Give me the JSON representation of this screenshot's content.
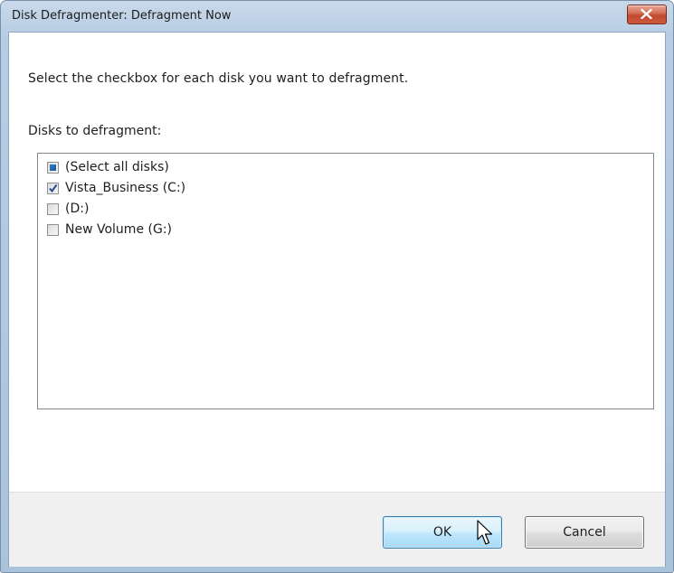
{
  "window": {
    "title": "Disk Defragmenter: Defragment Now"
  },
  "dialog": {
    "instruction": "Select the checkbox for each disk you want to defragment.",
    "list_label": "Disks to defragment:",
    "disks": [
      {
        "label": "(Select all disks)",
        "state": "indeterminate"
      },
      {
        "label": "Vista_Business (C:)",
        "state": "checked"
      },
      {
        "label": "(D:)",
        "state": "unchecked"
      },
      {
        "label": "New Volume (G:)",
        "state": "unchecked"
      }
    ]
  },
  "buttons": {
    "ok": "OK",
    "cancel": "Cancel"
  },
  "icons": {
    "close": "close-icon",
    "checkmark": "checkmark-icon",
    "cursor": "mouse-pointer-icon"
  },
  "colors": {
    "accent": "#3c7fb1",
    "close_button": "#c14a30",
    "indeterminate": "#1a5a9a"
  }
}
